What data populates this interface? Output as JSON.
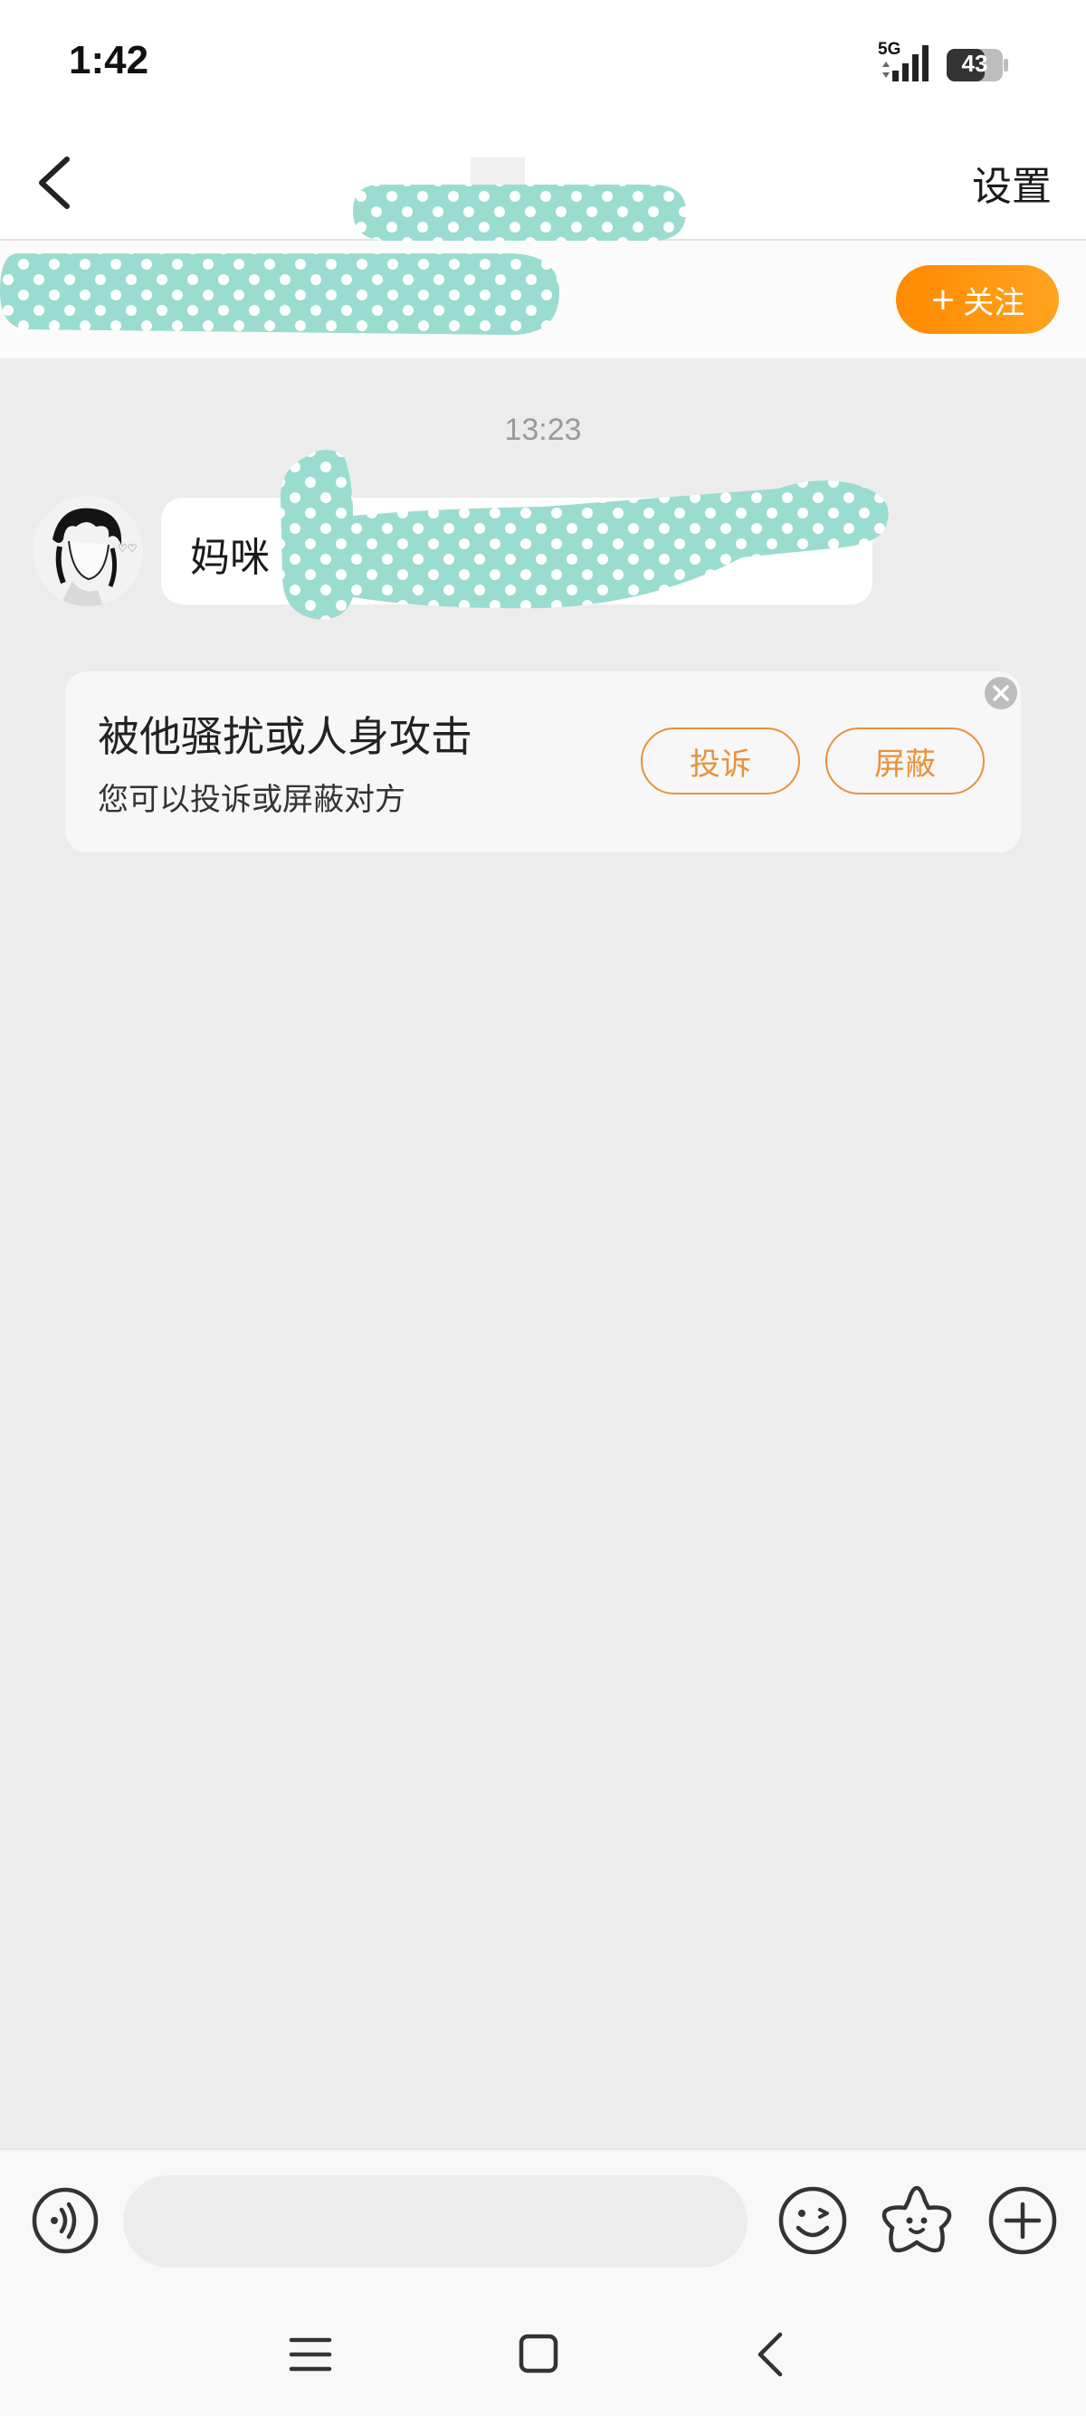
{
  "status_bar": {
    "time": "1:42",
    "network": "5G",
    "battery": "43"
  },
  "header": {
    "settings_label": "设置"
  },
  "follow_bar": {
    "follow_label": "关注",
    "follow_plus": "+"
  },
  "chat": {
    "timestamp": "13:23",
    "messages": [
      {
        "text": "妈咪"
      }
    ]
  },
  "safety_card": {
    "title": "被他骚扰或人身攻击",
    "subtitle": "您可以投诉或屏蔽对方",
    "report_label": "投诉",
    "block_label": "屏蔽"
  },
  "input_bar": {
    "placeholder": ""
  },
  "colors": {
    "accent": "#ff8a00",
    "redaction": "#9bdcd0",
    "background": "#ececec"
  }
}
